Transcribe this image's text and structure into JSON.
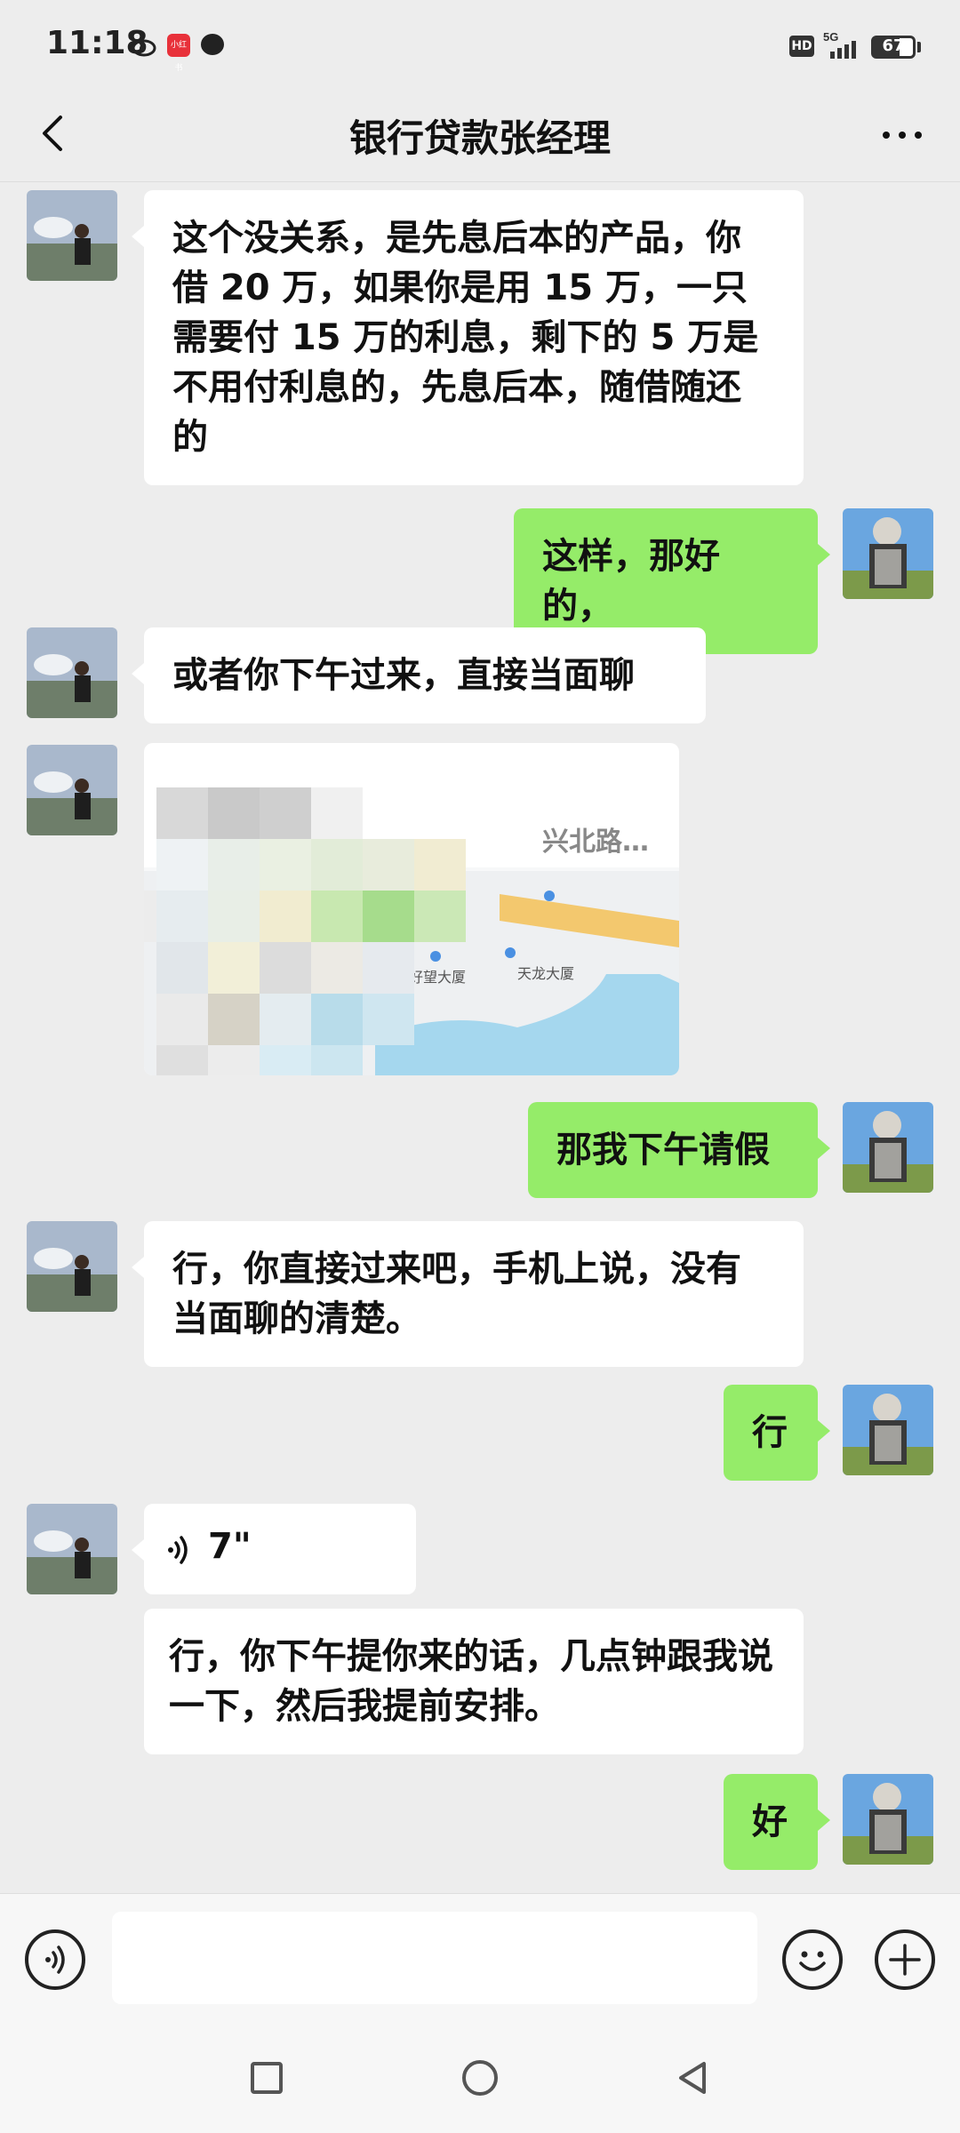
{
  "status_bar": {
    "time": "11:18",
    "network": "5G",
    "hd_label": "HD",
    "battery": "67",
    "app_badge": "小红书"
  },
  "header": {
    "title": "银行贷款张经理",
    "back_icon": "chevron-left-icon",
    "more_icon": "more-dots-icon"
  },
  "messages": [
    {
      "side": "left",
      "type": "text",
      "text": "这个没关系，是先息后本的产品，你借 20 万，如果你是用 15 万，一只需要付 15 万的利息，剩下的 5 万是不用付利息的，先息后本，随借随还的"
    },
    {
      "side": "right",
      "type": "text",
      "text": "这样，那好的，"
    },
    {
      "side": "left",
      "type": "text",
      "text": "或者你下午过来，直接当面聊"
    },
    {
      "side": "left",
      "type": "location",
      "label": "兴北路…",
      "poi_1": "好望大厦",
      "poi_2": "天龙大厦"
    },
    {
      "side": "right",
      "type": "text",
      "text": "那我下午请假"
    },
    {
      "side": "left",
      "type": "text",
      "text": "行，你直接过来吧，手机上说，没有当面聊的清楚。"
    },
    {
      "side": "right",
      "type": "text",
      "text": "行"
    },
    {
      "side": "left",
      "type": "voice",
      "duration": "7\""
    },
    {
      "side": "left",
      "type": "text",
      "text": "行，你下午提你来的话，几点钟跟我说一下，然后我提前安排。"
    },
    {
      "side": "right",
      "type": "text",
      "text": "好"
    }
  ],
  "input_bar": {
    "placeholder": "",
    "voice_icon": "voice-mode-icon",
    "emoji_icon": "emoji-icon",
    "plus_icon": "plus-icon"
  },
  "colors": {
    "background": "#ededed",
    "bubble_self": "#95ec69",
    "bubble_other": "#ffffff"
  }
}
